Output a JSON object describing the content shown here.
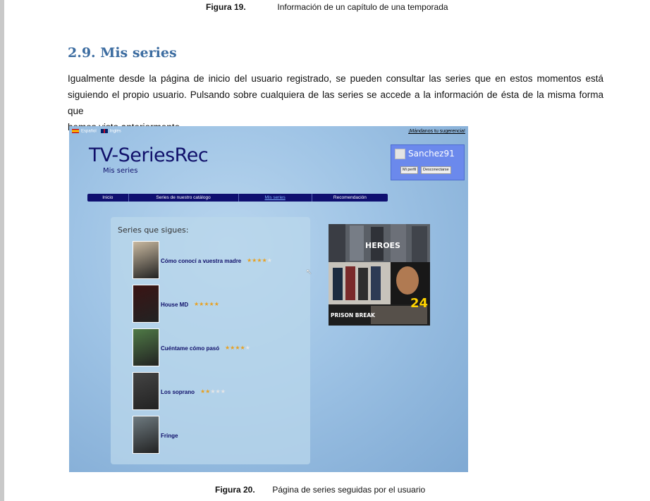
{
  "caption_top": {
    "label": "Figura 19.",
    "text": "Información de un capítulo de una temporada"
  },
  "heading": "2.9.  Mis series",
  "paragraph_lines": [
    "Igualmente desde la página de inicio del usuario registrado, se pueden consultar las series que en estos momentos está",
    "siguiendo el propio usuario. Pulsando sobre cualquiera de las series se accede a la información de ésta de la misma forma que",
    "hemos visto anteriormente."
  ],
  "screenshot": {
    "lang_es": "Español",
    "lang_en": "Inglés",
    "suggest_link": "¡Mándanos tu sugerencia!",
    "logo": "TV-SeriesRec",
    "subtitle": "Mis series",
    "user": {
      "name": "Sanchez91",
      "profile_button": "Mi perfil",
      "logout_button": "Desconectarse"
    },
    "nav": [
      "Inicio",
      "Series de nuestro catálogo",
      "Mis series",
      "Recomendación"
    ],
    "panel_title": "Series que sigues:",
    "series": [
      {
        "name": "Cómo conocí a vuestra madre",
        "rating": 4,
        "poster_color": "#c9b9a0"
      },
      {
        "name": "House MD",
        "rating": 5,
        "poster_color": "#3a1414"
      },
      {
        "name": "Cuéntame cómo pasó",
        "rating": 4,
        "poster_color": "#4f7a46"
      },
      {
        "name": "Los soprano",
        "rating": 2,
        "poster_color": "#444444"
      },
      {
        "name": "Fringe",
        "rating": 0,
        "poster_color": "#6e7a80"
      }
    ],
    "collage_titles": [
      "HEROES",
      "24",
      "PRISON BREAK"
    ]
  },
  "caption_bottom": {
    "label": "Figura 20.",
    "text": "Página de series seguidas por el usuario"
  }
}
